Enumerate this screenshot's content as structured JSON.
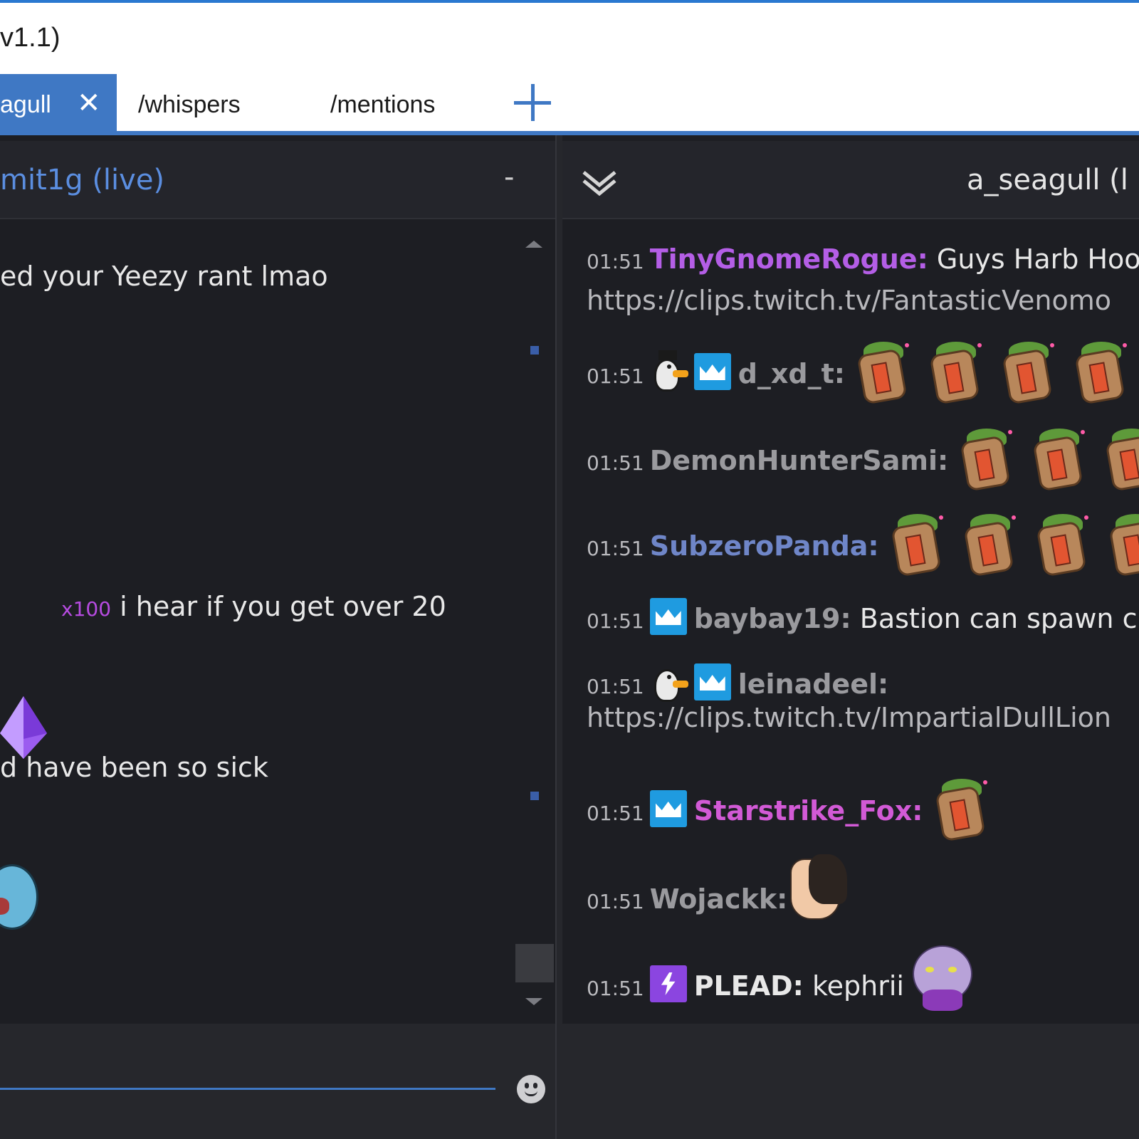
{
  "window": {
    "title_fragment": "v1.1)"
  },
  "tabs": [
    {
      "label": "agull",
      "active": true
    },
    {
      "label": "/whispers",
      "active": false
    },
    {
      "label": "/mentions",
      "active": false
    }
  ],
  "left_pane": {
    "header_title": "mit1g (live)",
    "header_menu": "-",
    "messages": [
      {
        "text": "ed your Yeezy rant lmao"
      },
      {
        "text": "\\"
      },
      {
        "bits": "x100",
        "text": "i hear if you get over 20"
      },
      {
        "text": "d have been so sick"
      }
    ]
  },
  "right_pane": {
    "header_title": "a_seagull (l",
    "messages": [
      {
        "time": "01:51",
        "user": "TinyGnomeRogue:",
        "user_color": "#b45ee6",
        "text": "Guys Harb Hoo",
        "link": "https://clips.twitch.tv/FantasticVenomo"
      },
      {
        "time": "01:51",
        "user": "d_xd_t:",
        "user_color": "#9a9a9e",
        "badges": [
          "penguin-badge",
          "crown-badge"
        ],
        "emotes": 4
      },
      {
        "time": "01:51",
        "user": "DemonHunterSami:",
        "user_color": "#9a9a9e",
        "emotes": 3
      },
      {
        "time": "01:51",
        "user": "SubzeroPanda:",
        "user_color": "#6f86c8",
        "emotes": 4
      },
      {
        "time": "01:51",
        "user": "baybay19:",
        "user_color": "#9a9a9e",
        "badges": [
          "crown-badge"
        ],
        "text": "Bastion can spawn c"
      },
      {
        "time": "01:51",
        "user": "leinadeel:",
        "user_color": "#9a9a9e",
        "badges": [
          "penguin-badge",
          "crown-badge"
        ],
        "link": "https://clips.twitch.tv/ImpartialDullLion"
      },
      {
        "time": "01:51",
        "user": "Starstrike_Fox:",
        "user_color": "#d25ad6",
        "badges": [
          "crown-badge"
        ],
        "emotes": 1
      },
      {
        "time": "01:51",
        "user": "Wojackk:",
        "user_color": "#9a9a9e"
      },
      {
        "time": "01:51",
        "user": "PLEAD:",
        "user_color": "#e8e8e8",
        "badges": [
          "prime-badge"
        ],
        "text": "kephrii"
      }
    ]
  },
  "colors": {
    "accent": "#3f78c4",
    "background": "#1d1e23",
    "header_bg": "#24252b",
    "left_title": "#5b8ee0"
  },
  "icons": [
    "close-icon",
    "plus-icon",
    "chevron-down-icon",
    "emoji-icon",
    "crown-badge",
    "prime-badge",
    "penguin-badge"
  ]
}
